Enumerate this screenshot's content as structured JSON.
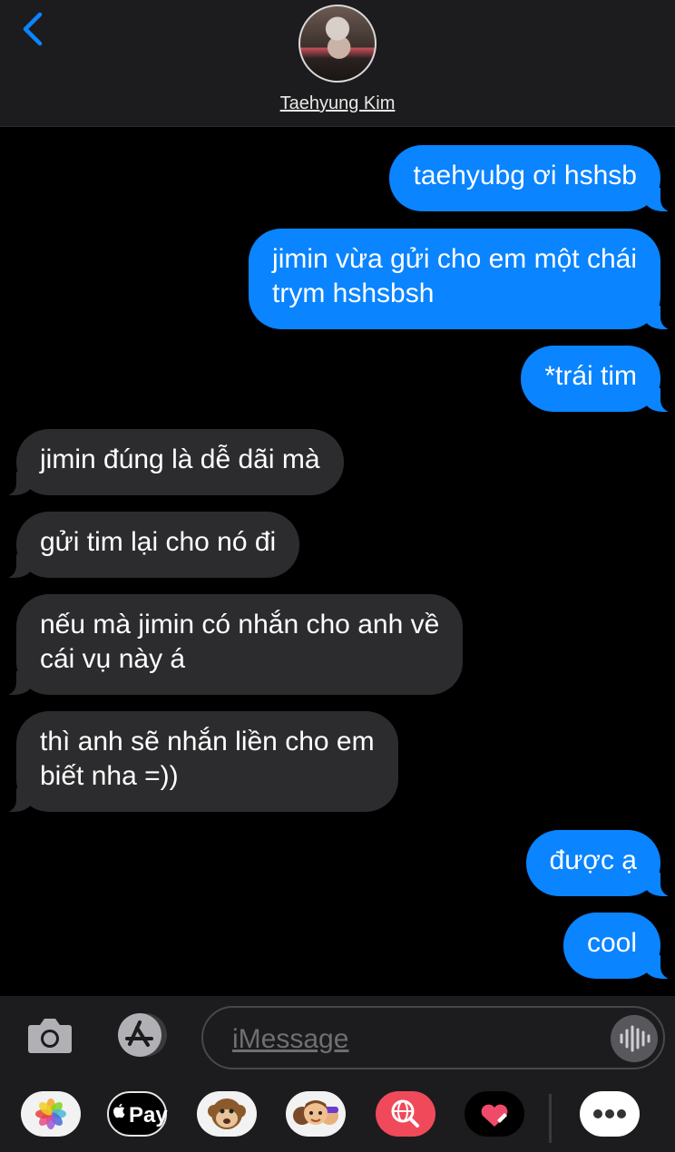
{
  "header": {
    "contact_name": "Taehyung Kim",
    "back_icon": "chevron-left-icon",
    "accent": "#0a84ff"
  },
  "messages": [
    {
      "dir": "out",
      "text": "taehyubg ơi hshsb"
    },
    {
      "dir": "out",
      "text": "jimin vừa gửi cho em một chái"
    },
    {
      "dir": "out",
      "text": "trym hshsbsh"
    },
    {
      "dir": "out",
      "text": "*trái tim"
    },
    {
      "dir": "in",
      "text": "jimin đúng là dễ dãi mà"
    },
    {
      "dir": "in",
      "text": "gửi tim lại cho nó đi"
    },
    {
      "dir": "in",
      "text": "nếu mà jimin có nhắn cho anh về"
    },
    {
      "dir": "in",
      "text": "cái vụ này á"
    },
    {
      "dir": "in",
      "text": "thì anh sẽ nhắn liền cho em"
    },
    {
      "dir": "in",
      "text": "biết nha =))"
    },
    {
      "dir": "out",
      "text": "được ạ"
    },
    {
      "dir": "out",
      "text": "cool"
    }
  ],
  "input": {
    "placeholder": "iMessage",
    "camera_icon": "camera-icon",
    "appstore_icon": "app-store-icon",
    "audio_icon": "audio-waveform-icon"
  },
  "drawer": {
    "apple_pay_label": "Pay",
    "apps": [
      "photos-icon",
      "apple-pay-icon",
      "monkey-animoji-icon",
      "memoji-stickers-icon",
      "web-images-search-icon",
      "digital-touch-icon",
      "more-apps-icon"
    ]
  },
  "colors": {
    "outgoing": "#0a84ff",
    "incoming": "#2c2c2e",
    "background": "#000000"
  }
}
